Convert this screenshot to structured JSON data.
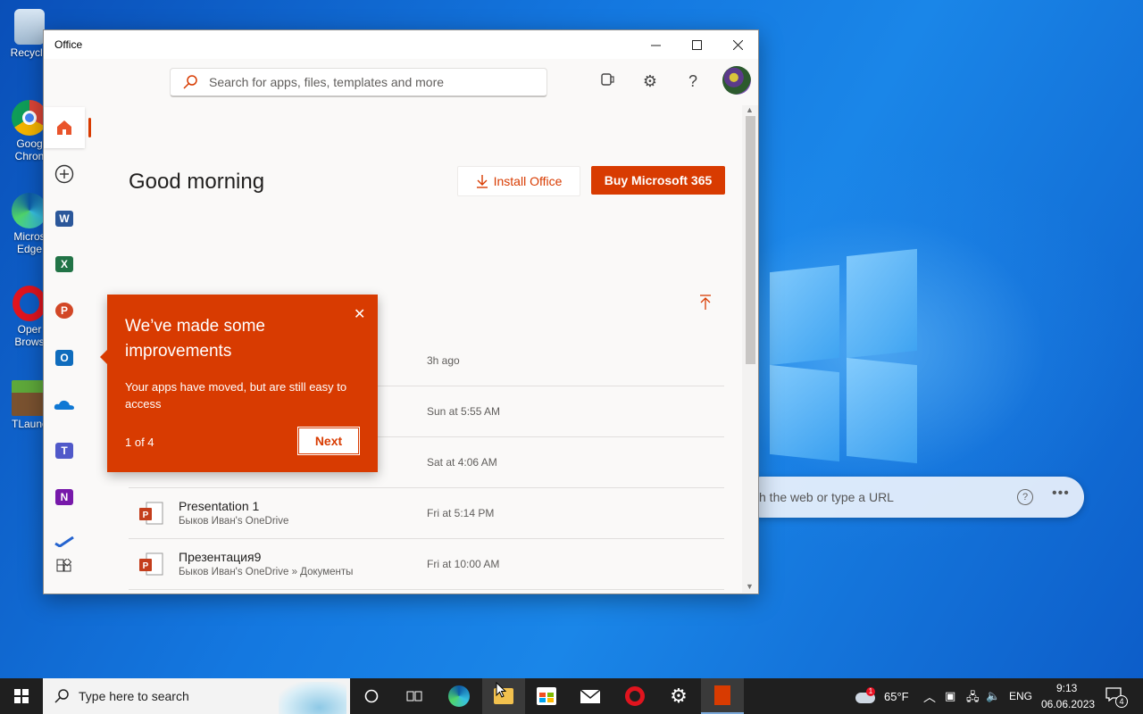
{
  "window": {
    "title": "Office"
  },
  "header": {
    "search_placeholder": "Search for apps, files, templates and more"
  },
  "main": {
    "greeting": "Good morning",
    "install_label": "Install Office",
    "buy_label": "Buy Microsoft 365"
  },
  "files": [
    {
      "name": "",
      "location": "",
      "time": "3h ago",
      "app": "word"
    },
    {
      "name": "",
      "location": "",
      "time": "Sun at 5:55 AM",
      "app": "word"
    },
    {
      "name": "",
      "location": "",
      "time": "Sat at 4:06 AM",
      "app": "ppt"
    },
    {
      "name": "Presentation 1",
      "location": "Быков Иван's OneDrive",
      "time": "Fri at 5:14 PM",
      "app": "ppt"
    },
    {
      "name": "Презентация9",
      "location": "Быков Иван's OneDrive » Документы",
      "time": "Fri at 10:00 AM",
      "app": "ppt"
    }
  ],
  "callout": {
    "title": "We’ve made some improvements",
    "body": "Your apps have moved, but are still easy to access",
    "count": "1 of 4",
    "next_label": "Next"
  },
  "desktop": {
    "icons": [
      "Recycle",
      "Goog Chron",
      "Micros Edge",
      "Oper Brows",
      "TLaunc"
    ],
    "edge_search_text": "h the web or type a URL"
  },
  "taskbar": {
    "search_placeholder": "Type here to search",
    "weather": "65°F",
    "lang": "ENG",
    "time": "9:13",
    "date": "06.06.2023",
    "notifications": "4",
    "weather_badge": "1"
  },
  "colors": {
    "accent": "#d83b01",
    "taskbar": "#1f1f1f"
  }
}
